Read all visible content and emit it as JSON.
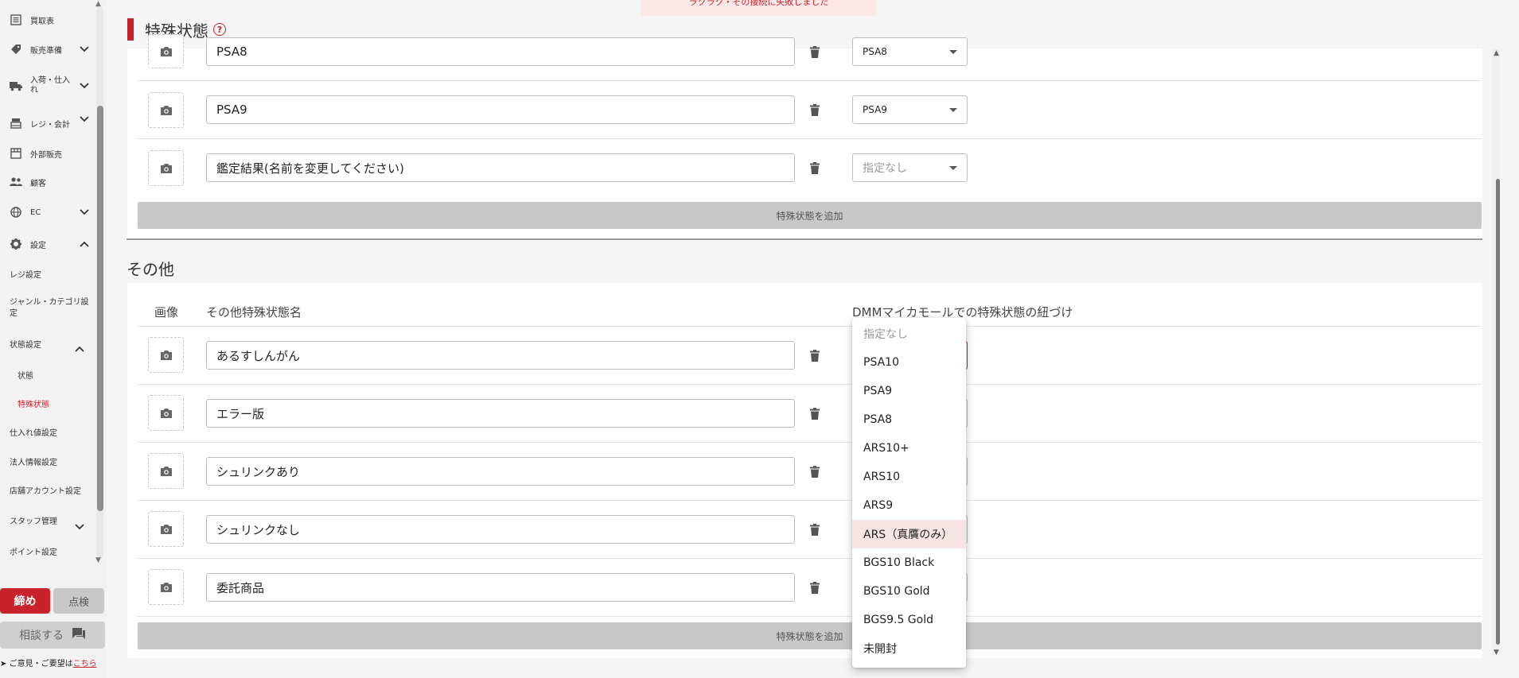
{
  "toast": {
    "text": "ラクラク・その接続に失敗しました"
  },
  "sidebar": {
    "items": [
      {
        "label": "買取表",
        "icon": "list-icon"
      },
      {
        "label": "販売準備",
        "icon": "tag-icon"
      },
      {
        "label": "入荷・仕入れ",
        "icon": "truck-icon"
      },
      {
        "label": "レジ・会計",
        "icon": "register-icon"
      },
      {
        "label": "外部販売",
        "icon": "store-icon"
      },
      {
        "label": "顧客",
        "icon": "people-icon"
      },
      {
        "label": "EC",
        "icon": "globe-icon"
      },
      {
        "label": "設定",
        "icon": "gear-icon"
      }
    ],
    "settings_sub": [
      "レジ設定",
      "ジャンル・カテゴリ設定",
      "状態設定",
      "状態",
      "特殊状態",
      "仕入れ値設定",
      "法人情報設定",
      "店舗アカウント設定",
      "スタッフ管理",
      "ポイント設定"
    ],
    "close_label": "締め",
    "check_label": "点検",
    "consult_label": "相談する",
    "feedback_text": "ご意見・ご要望は",
    "feedback_link": "こちら"
  },
  "section1": {
    "title": "特殊状態",
    "help": "?",
    "rows": [
      {
        "name": "PSA8",
        "mapping": "PSA8"
      },
      {
        "name": "PSA9",
        "mapping": "PSA9"
      },
      {
        "name": "鑑定結果(名前を変更してください)",
        "mapping": "指定なし"
      }
    ],
    "add_label": "特殊状態を追加"
  },
  "section2": {
    "title": "その他",
    "col_image": "画像",
    "col_name": "その他特殊状態名",
    "col_mapping": "DMMマイカモールでの特殊状態の紐づけ",
    "rows": [
      {
        "name": "あるすしんがん"
      },
      {
        "name": "エラー版"
      },
      {
        "name": "シュリンクあり"
      },
      {
        "name": "シュリンクなし"
      },
      {
        "name": "委託商品"
      }
    ],
    "add_label": "特殊状態を追加"
  },
  "dropdown": {
    "options": [
      "指定なし",
      "PSA10",
      "PSA9",
      "PSA8",
      "ARS10+",
      "ARS10",
      "ARS9",
      "ARS（真贋のみ）",
      "BGS10 Black",
      "BGS10 Gold",
      "BGS9.5 Gold",
      "未開封"
    ],
    "highlighted": "ARS（真贋のみ）"
  },
  "colors": {
    "accent": "#c8222a",
    "highlight": "#f6e4e4"
  }
}
